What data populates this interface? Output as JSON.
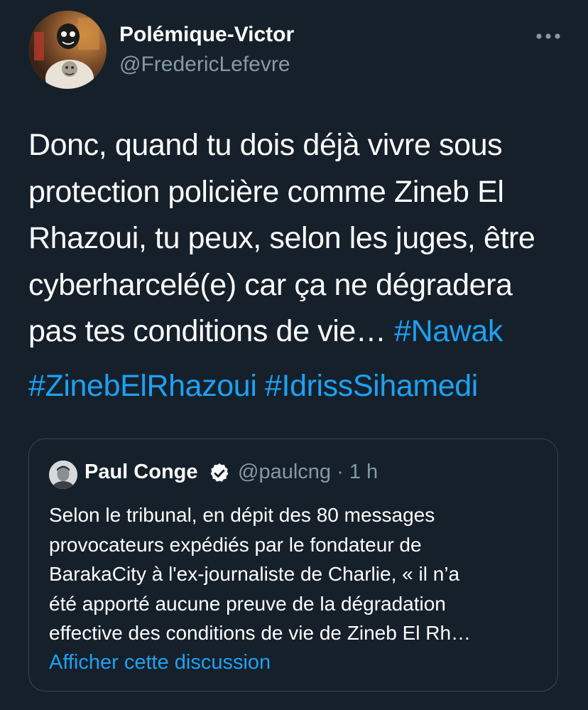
{
  "tweet": {
    "author_name": "Polémique-Victor",
    "author_handle": "@FredericLefevre",
    "more_icon": "more-horizontal-icon",
    "text_lines": [
      "Donc, quand tu dois déjà vivre sous",
      "protection policière comme Zineb El",
      "Rhazoui, tu peux, selon les juges, être",
      "cyberharcelé(e) car ça ne dégradera",
      "pas tes conditions de vie…"
    ],
    "inline_hashtag": "#Nawak",
    "hashtags": [
      "#ZinebElRhazoui",
      "#IdrissSihamedi"
    ]
  },
  "quote": {
    "author_name": "Paul Conge",
    "verified_icon": "verified-badge-icon",
    "author_handle": "@paulcng",
    "separator": "·",
    "time": "1 h",
    "text_lines": [
      "Selon le tribunal, en dépit des 80 messages",
      "provocateurs expédiés par le fondateur de",
      "BarakaCity à l'ex-journaliste de Charlie, « il n’a",
      "été apporté aucune preuve de la dégradation",
      "effective des conditions de vie de Zineb El Rh…"
    ],
    "link_label": "Afficher cette discussion"
  },
  "colors": {
    "background": "#15202b",
    "text": "#ffffff",
    "secondary_text": "#8899a6",
    "link": "#1da1f2",
    "border": "#38444d"
  }
}
